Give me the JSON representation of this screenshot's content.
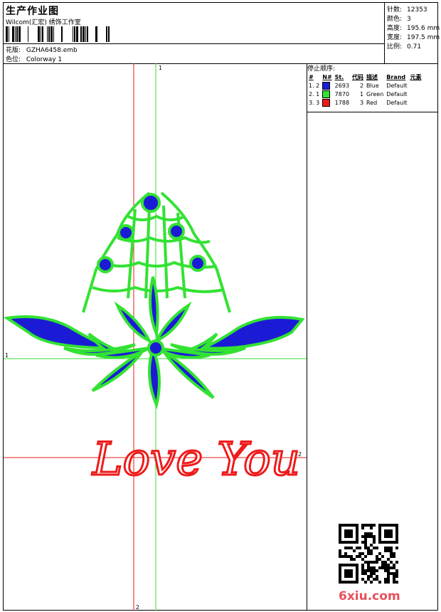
{
  "header": {
    "title": "生产作业图",
    "company": "Wilcom(汇宏) 绣饰工作室",
    "design_label": "花版:",
    "design_value": "GZHA6458.emb",
    "colorway_label": "色位:",
    "colorway_value": "Colorway 1"
  },
  "stats": [
    {
      "label": "针数:",
      "value": "12353"
    },
    {
      "label": "颜色:",
      "value": "3"
    },
    {
      "label": "高度:",
      "value": "195.6 mm"
    },
    {
      "label": "宽度:",
      "value": "197.5 mm"
    },
    {
      "label": "比例:",
      "value": "0.71"
    }
  ],
  "stop_sequence": {
    "title": "停止顺序:",
    "columns": [
      "#",
      "N#",
      "St.",
      "代码",
      "描述",
      "Brand",
      "元素"
    ],
    "rows": [
      {
        "num": "1. 2",
        "color": "#1b1bd6",
        "stitches": "2693",
        "code": "2",
        "desc": "Blue",
        "brand": "Default"
      },
      {
        "num": "2. 1",
        "color": "#33e233",
        "stitches": "7870",
        "code": "1",
        "desc": "Green",
        "brand": "Default"
      },
      {
        "num": "3. 3",
        "color": "#ee1b1b",
        "stitches": "1788",
        "code": "3",
        "desc": "Red",
        "brand": "Default"
      }
    ]
  },
  "design": {
    "text": "Love You",
    "guide_labels": {
      "green_v": "1",
      "green_h": "1",
      "red_h": "2",
      "red_v": "2"
    },
    "colors": {
      "blue": "#1b1bd6",
      "green": "#33e233",
      "red": "#ee1b1b"
    }
  },
  "watermark": "6xiu.com"
}
